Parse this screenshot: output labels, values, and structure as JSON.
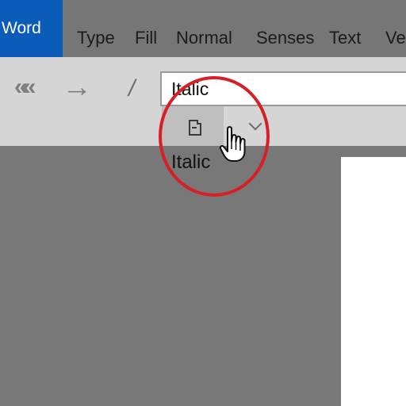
{
  "menubar": {
    "app_title": "Word",
    "items": [
      {
        "label": "Type"
      },
      {
        "label": "Fill"
      },
      {
        "label": "Normal"
      },
      {
        "label": "Senses"
      },
      {
        "label": "Text"
      },
      {
        "label": "Ve"
      }
    ]
  },
  "toolbar": {
    "back_icon": "double-chevron-left-icon",
    "forward_icon": "arrow-right-icon",
    "slash_icon": "slash-icon",
    "address_value": "Italic",
    "ribbon_button_icon": "document-icon",
    "ribbon_button_label": "Italic",
    "dropdown_icon": "chevron-down-icon"
  },
  "colors": {
    "app_accent": "#0b5cb8",
    "highlight": "#d61f26",
    "background": "#787878",
    "toolbar": "#d5d5d5"
  }
}
